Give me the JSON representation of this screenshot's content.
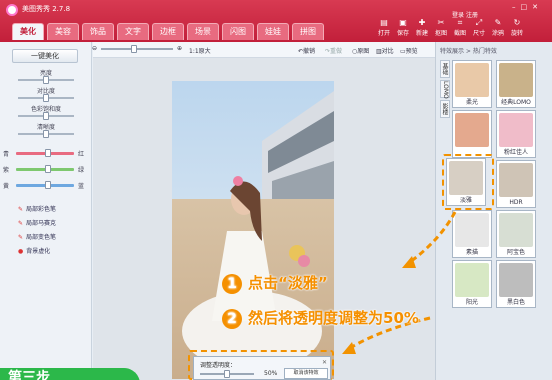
{
  "app": {
    "title": "美图秀秀 2.7.8"
  },
  "tabs": [
    {
      "label": "美化"
    },
    {
      "label": "美容"
    },
    {
      "label": "饰品"
    },
    {
      "label": "文字"
    },
    {
      "label": "边框"
    },
    {
      "label": "场景"
    },
    {
      "label": "闪图"
    },
    {
      "label": "娃娃"
    },
    {
      "label": "拼图"
    }
  ],
  "toolbar_actions": [
    {
      "label": "打开"
    },
    {
      "label": "保存"
    },
    {
      "label": "新建"
    },
    {
      "label": "抠图"
    },
    {
      "label": "截图"
    },
    {
      "label": "尺寸"
    },
    {
      "label": "涂鸦"
    },
    {
      "label": "旋转"
    }
  ],
  "account": {
    "login": "登录",
    "signup": "注册"
  },
  "left": {
    "onekey": "一键美化",
    "sliders": [
      {
        "label": "亮度",
        "level": 0.5
      },
      {
        "label": "对比度",
        "level": 0.5
      },
      {
        "label": "色彩饱和度",
        "level": 0.5
      },
      {
        "label": "清晰度",
        "level": 0.5
      }
    ],
    "color_bars": [
      {
        "left": "青",
        "right": "红",
        "color": "#e86b80",
        "level": 0.55
      },
      {
        "left": "紫",
        "right": "绿",
        "color": "#7ec86f",
        "level": 0.55
      },
      {
        "left": "黄",
        "right": "蓝",
        "color": "#6ea8e0",
        "level": 0.55
      }
    ],
    "brushes": [
      {
        "label": "局部彩色笔"
      },
      {
        "label": "局部马赛克"
      },
      {
        "label": "局部变色笔"
      },
      {
        "label": "背景虚化"
      }
    ]
  },
  "canvas_toolbar": {
    "zoom_label": "1:1原大",
    "undo": "撤销",
    "redo": "重做",
    "original": "原图",
    "compare": "对比",
    "preview": "预览"
  },
  "effects": {
    "header": "特效展示 > 热门特效",
    "side_tabs": [
      {
        "label": "基础"
      },
      {
        "label": "LOMO"
      },
      {
        "label": "影楼"
      }
    ],
    "items": [
      {
        "label": "柔光"
      },
      {
        "label": "经典LOMO"
      },
      {
        "label": ""
      },
      {
        "label": "粉红佳人"
      },
      {
        "label": "淡雅"
      },
      {
        "label": "HDR"
      },
      {
        "label": "素描"
      },
      {
        "label": "阿宝色"
      },
      {
        "label": "阳光"
      },
      {
        "label": "黑白色"
      }
    ]
  },
  "annotations": {
    "step1": {
      "num": "1",
      "text": "点击“淡雅”"
    },
    "step2": {
      "num": "2",
      "text": "然后将透明度调整为50%"
    }
  },
  "opacity_dialog": {
    "title": "调整透明度：",
    "value": "50%",
    "level": 0.5,
    "cancel": "取消该特效"
  },
  "corner_badge": {
    "text": "第三步"
  },
  "colors": {
    "title": "#c21f3a",
    "accent": "#f59000",
    "badge": "#2cb84a"
  }
}
